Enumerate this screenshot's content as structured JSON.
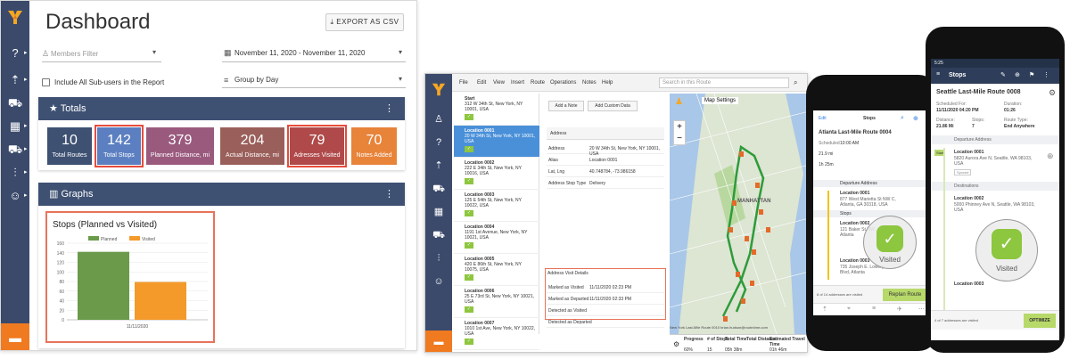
{
  "dashboard": {
    "title": "Dashboard",
    "export_label": "EXPORT AS CSV",
    "members_placeholder": "Members Filter",
    "date_range": "November 11, 2020 - November 11, 2020",
    "subusers_label": "Include All Sub-users in the Report",
    "group_by": "Group by Day",
    "totals_title": "Totals",
    "graphs_title": "Graphs",
    "tiles": [
      {
        "value": "10",
        "label": "Total Routes",
        "color": "#3e5173"
      },
      {
        "value": "142",
        "label": "Total Stops",
        "color": "#5b7fc0"
      },
      {
        "value": "379",
        "label": "Planned Distance, mi",
        "color": "#9a5a7e"
      },
      {
        "value": "204",
        "label": "Actual Distance, mi",
        "color": "#9a5f5a"
      },
      {
        "value": "79",
        "label": "Adresses Visited",
        "color": "#b04a4a"
      },
      {
        "value": "70",
        "label": "Notes Added",
        "color": "#e8833a"
      }
    ]
  },
  "chart_data": {
    "type": "bar",
    "title": "Stops (Planned vs Visited)",
    "categories": [
      "11/11/2020"
    ],
    "series": [
      {
        "name": "Planned",
        "values": [
          142
        ],
        "color": "#6a9a4a"
      },
      {
        "name": "Visited",
        "values": [
          79
        ],
        "color": "#f39a2a"
      }
    ],
    "yticks": [
      "0",
      "20",
      "40",
      "60",
      "80",
      "100",
      "120",
      "140",
      "160"
    ],
    "ylim": [
      0,
      160
    ],
    "legend_position": "top"
  },
  "app": {
    "menu": [
      "File",
      "Edit",
      "View",
      "Insert",
      "Route",
      "Operations",
      "Notes",
      "Help"
    ],
    "search_placeholder": "Search in this Route",
    "add_note": "Add a Note",
    "add_custom": "Add Custom Data",
    "address_header": "Address",
    "address_rows": [
      {
        "k": "Address",
        "v": "20 W 34th St, New York, NY 10001, USA"
      },
      {
        "k": "Alias",
        "v": "Location 0001"
      },
      {
        "k": "Lat, Lng",
        "v": "40.748784, -73.986158"
      },
      {
        "k": "Address Stop Type",
        "v": "Delivery"
      }
    ],
    "visit_header": "Address Visit Details",
    "visit_rows": [
      {
        "k": "Marked as Visited",
        "v": "11/11/2020 02:23 PM"
      },
      {
        "k": "Marked as Departed",
        "v": "11/11/2020 02:33 PM"
      },
      {
        "k": "Detected as Visited",
        "v": ""
      },
      {
        "k": "Detected as Departed",
        "v": ""
      }
    ],
    "map_settings": "Map Settings",
    "map_label": "MANHATTAN",
    "stops": [
      {
        "title": "Start",
        "addr": "312 W 34th St, New York, NY 10001, USA"
      },
      {
        "title": "Location 0001",
        "addr": "20 W 34th St, New York, NY 10001, USA"
      },
      {
        "title": "Location 0002",
        "addr": "222 E 34th St, New York, NY 10016, USA"
      },
      {
        "title": "Location 0003",
        "addr": "125 E 54th St, New York, NY 10022, USA"
      },
      {
        "title": "Location 0004",
        "addr": "1191 1st Avenue, New York, NY 10021, USA"
      },
      {
        "title": "Location 0005",
        "addr": "420 E 86th St, New York, NY 10075, USA"
      },
      {
        "title": "Location 0006",
        "addr": "25 E 73rd St, New York, NY 10021, USA"
      },
      {
        "title": "Location 0007",
        "addr": "1010 1st Ave, New York, NY 10022, USA"
      }
    ],
    "route_caption": "New York Last-Mile Route 0010 brian.hudson@route4me.com",
    "table_headers": [
      "Progress",
      "# of Stops",
      "Total Time",
      "Total Distance",
      "Estimated Travel Time"
    ],
    "table_values": [
      "60%",
      "15",
      "05h 38m",
      "",
      "01h 46m"
    ]
  },
  "phone1": {
    "edit": "Edit",
    "title": "Stops",
    "route": "Atlanta Last-Mile Route 0004",
    "scheduled": "Scheduled",
    "time": "10:00 AM",
    "distance_val": "21.9 mi",
    "duration_val": "1h 25m",
    "departure": "Departure Address",
    "loc1": "Location 0001",
    "loc1_addr": "877 West Marietta St NW C, Atlanta, GA 30318, USA",
    "stops_label": "Stops",
    "loc2": "Location 0002",
    "loc2_addr": "121 Baker St NW, Atlanta",
    "loc3": "Location 0003",
    "loc3_addr": "735 Joseph E. Lowery Blvd, Atlanta",
    "visited": "Visited",
    "footer": "8 of 14 addresses are visited",
    "replan": "Replan Route"
  },
  "phone2": {
    "time": "5:25",
    "title": "Stops",
    "route": "Seattle Last-Mile Route 0008",
    "scheduled_for": "Scheduled For:",
    "scheduled_val": "11/11/2020 04:20 PM",
    "duration": "Duration:",
    "duration_val": "01:26",
    "distance": "Distance:",
    "distance_val": "21.86 Mi",
    "stops": "Stops:",
    "stops_val": "7",
    "route_type": "Route Type:",
    "route_type_val": "End Anywhere",
    "departure": "Departure Address",
    "start": "Start",
    "loc0": "Location 0001",
    "loc0_addr": "5820 Aurora Ave N, Seattle, WA 98103, USA",
    "synced": "Synced",
    "destinations": "Destinations",
    "loc1": "Location 0002",
    "loc1_addr": "5000 Phinney Ave N, Seattle, WA 98103, USA",
    "loc2": "Location 0003",
    "visited": "Visited",
    "footer": "4 of 7 addresses are visited",
    "optimize": "OPTIMIZE"
  }
}
